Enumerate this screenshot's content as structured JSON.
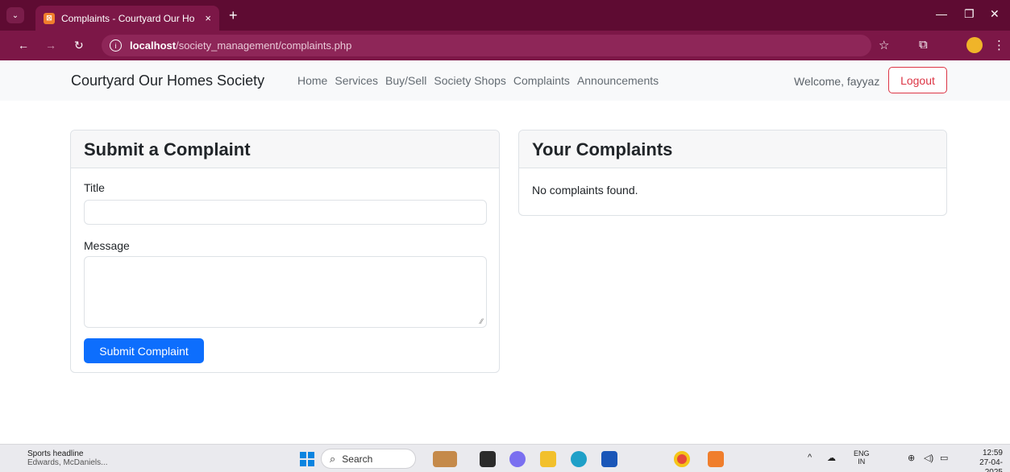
{
  "browser": {
    "tab_title": "Complaints - Courtyard Our Ho",
    "tab_close": "×",
    "new_tab": "+",
    "url_host": "localhost",
    "url_path": "/society_management/complaints.php",
    "minimize": "—",
    "restore": "❐",
    "close": "✕"
  },
  "site": {
    "brand": "Courtyard Our Homes Society",
    "nav": [
      "Home",
      "Services",
      "Buy/Sell",
      "Society Shops",
      "Complaints",
      "Announcements"
    ],
    "welcome": "Welcome, fayyaz",
    "logout": "Logout"
  },
  "submit_form": {
    "header": "Submit a Complaint",
    "title_label": "Title",
    "title_value": "",
    "message_label": "Message",
    "message_value": "",
    "submit_label": "Submit Complaint"
  },
  "your_complaints": {
    "header": "Your Complaints",
    "empty_text": "No complaints found."
  },
  "taskbar": {
    "news_title": "Sports headline",
    "news_sub": "Edwards, McDaniels...",
    "search_placeholder": "Search",
    "lang_top": "ENG",
    "lang_bottom": "IN",
    "time": "12:59",
    "date": "27-04-2025"
  },
  "colors": {
    "browser_frame": "#5e0b32",
    "primary": "#0d6efd",
    "danger": "#dc3545"
  }
}
